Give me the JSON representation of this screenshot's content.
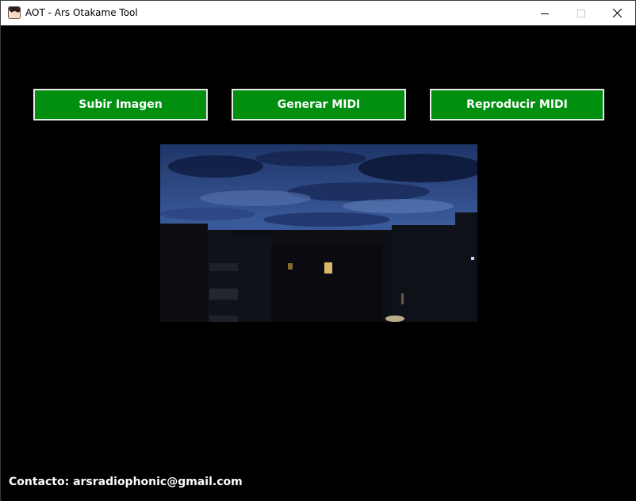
{
  "window": {
    "title": "AOT - Ars Otakame Tool",
    "icon": "anime-face-icon",
    "controls": [
      "minimize-icon",
      "maximize-icon",
      "close-icon"
    ]
  },
  "toolbar": {
    "upload_label": "Subir Imagen",
    "generate_label": "Generar MIDI",
    "play_label": "Reproducir MIDI",
    "button_color": "#008f0f"
  },
  "preview": {
    "image": "night-city-sky-photo"
  },
  "footer": {
    "contact": "Contacto: arsradiophonic@gmail.com"
  },
  "colors": {
    "background": "#000000",
    "button": "#008f0f",
    "text": "#ffffff"
  }
}
